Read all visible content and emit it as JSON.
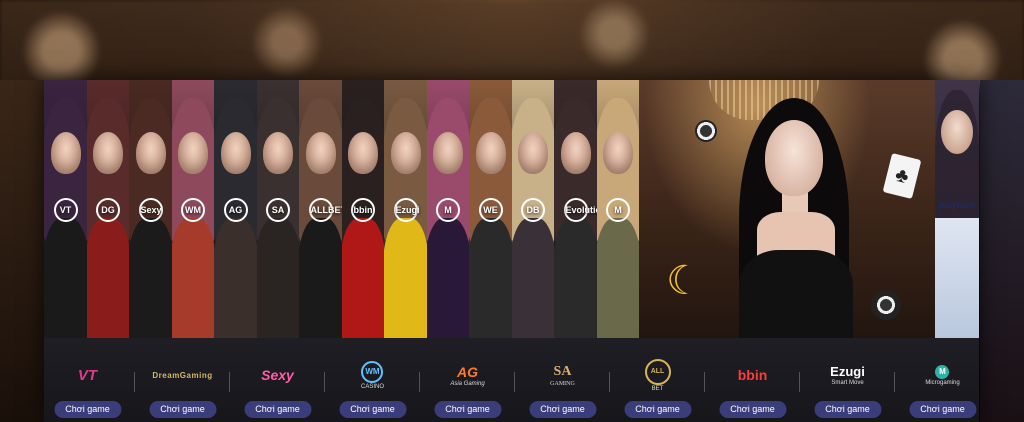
{
  "strips": [
    {
      "logo": "VT",
      "hair": "#3a2440",
      "body": "#1a1a1a"
    },
    {
      "logo": "DG",
      "hair": "#5a2b2b",
      "body": "#8a1c1c"
    },
    {
      "logo": "Sexy",
      "hair": "#4a2a22",
      "body": "#1b1b1b"
    },
    {
      "logo": "WM",
      "hair": "#8e4a5c",
      "body": "#a63b2c"
    },
    {
      "logo": "AG",
      "hair": "#2a2a30",
      "body": "#3a2f2a"
    },
    {
      "logo": "SA",
      "hair": "#3a3030",
      "body": "#2a2422"
    },
    {
      "logo": "ALLBET",
      "hair": "#6a4a3a",
      "body": "#1a1a1a"
    },
    {
      "logo": "bbin",
      "hair": "#2a2020",
      "body": "#b01818"
    },
    {
      "logo": "Ezugi",
      "hair": "#7a5a40",
      "body": "#e0b818"
    },
    {
      "logo": "M",
      "hair": "#9a4a6a",
      "body": "#2a1838"
    },
    {
      "logo": "WE",
      "hair": "#8a5a3a",
      "body": "#2a2a2a"
    },
    {
      "logo": "DB",
      "hair": "#c8b088",
      "body": "#3a3038"
    },
    {
      "logo": "Evolution",
      "hair": "#3a2a2a",
      "body": "#2a2a2a"
    },
    {
      "logo": "M",
      "hair": "#c8a878",
      "body": "#6a6a4a"
    }
  ],
  "hero": {
    "card_symbol": "♣",
    "logo_symbol": "☾"
  },
  "last_strip_logo": "playtech",
  "providers": [
    {
      "name": "VT",
      "sub": "",
      "style": "lg-vt",
      "button": "Chơi game"
    },
    {
      "name": "DreamGaming",
      "sub": "",
      "style": "lg-dg",
      "button": "Chơi game"
    },
    {
      "name": "Sexy",
      "sub": "",
      "style": "lg-sexy",
      "button": "Chơi game"
    },
    {
      "name": "WM",
      "sub": "CASINO",
      "style": "lg-wm",
      "button": "Chơi game"
    },
    {
      "name": "AG",
      "sub": "Asia Gaming",
      "style": "lg-ag",
      "button": "Chơi game"
    },
    {
      "name": "SA",
      "sub": "GAMING",
      "style": "lg-sa",
      "button": "Chơi game"
    },
    {
      "name": "ALL",
      "sub": "BET",
      "style": "lg-allbet",
      "button": "Chơi game"
    },
    {
      "name": "bbin",
      "sub": "",
      "style": "lg-bbin",
      "button": "Chơi game"
    },
    {
      "name": "Ezugi",
      "sub": "Smart Move",
      "style": "lg-ezugi",
      "button": "Chơi game"
    },
    {
      "name": "M",
      "sub": "Microgaming",
      "style": "lg-micro",
      "button": "Chơi game"
    }
  ]
}
